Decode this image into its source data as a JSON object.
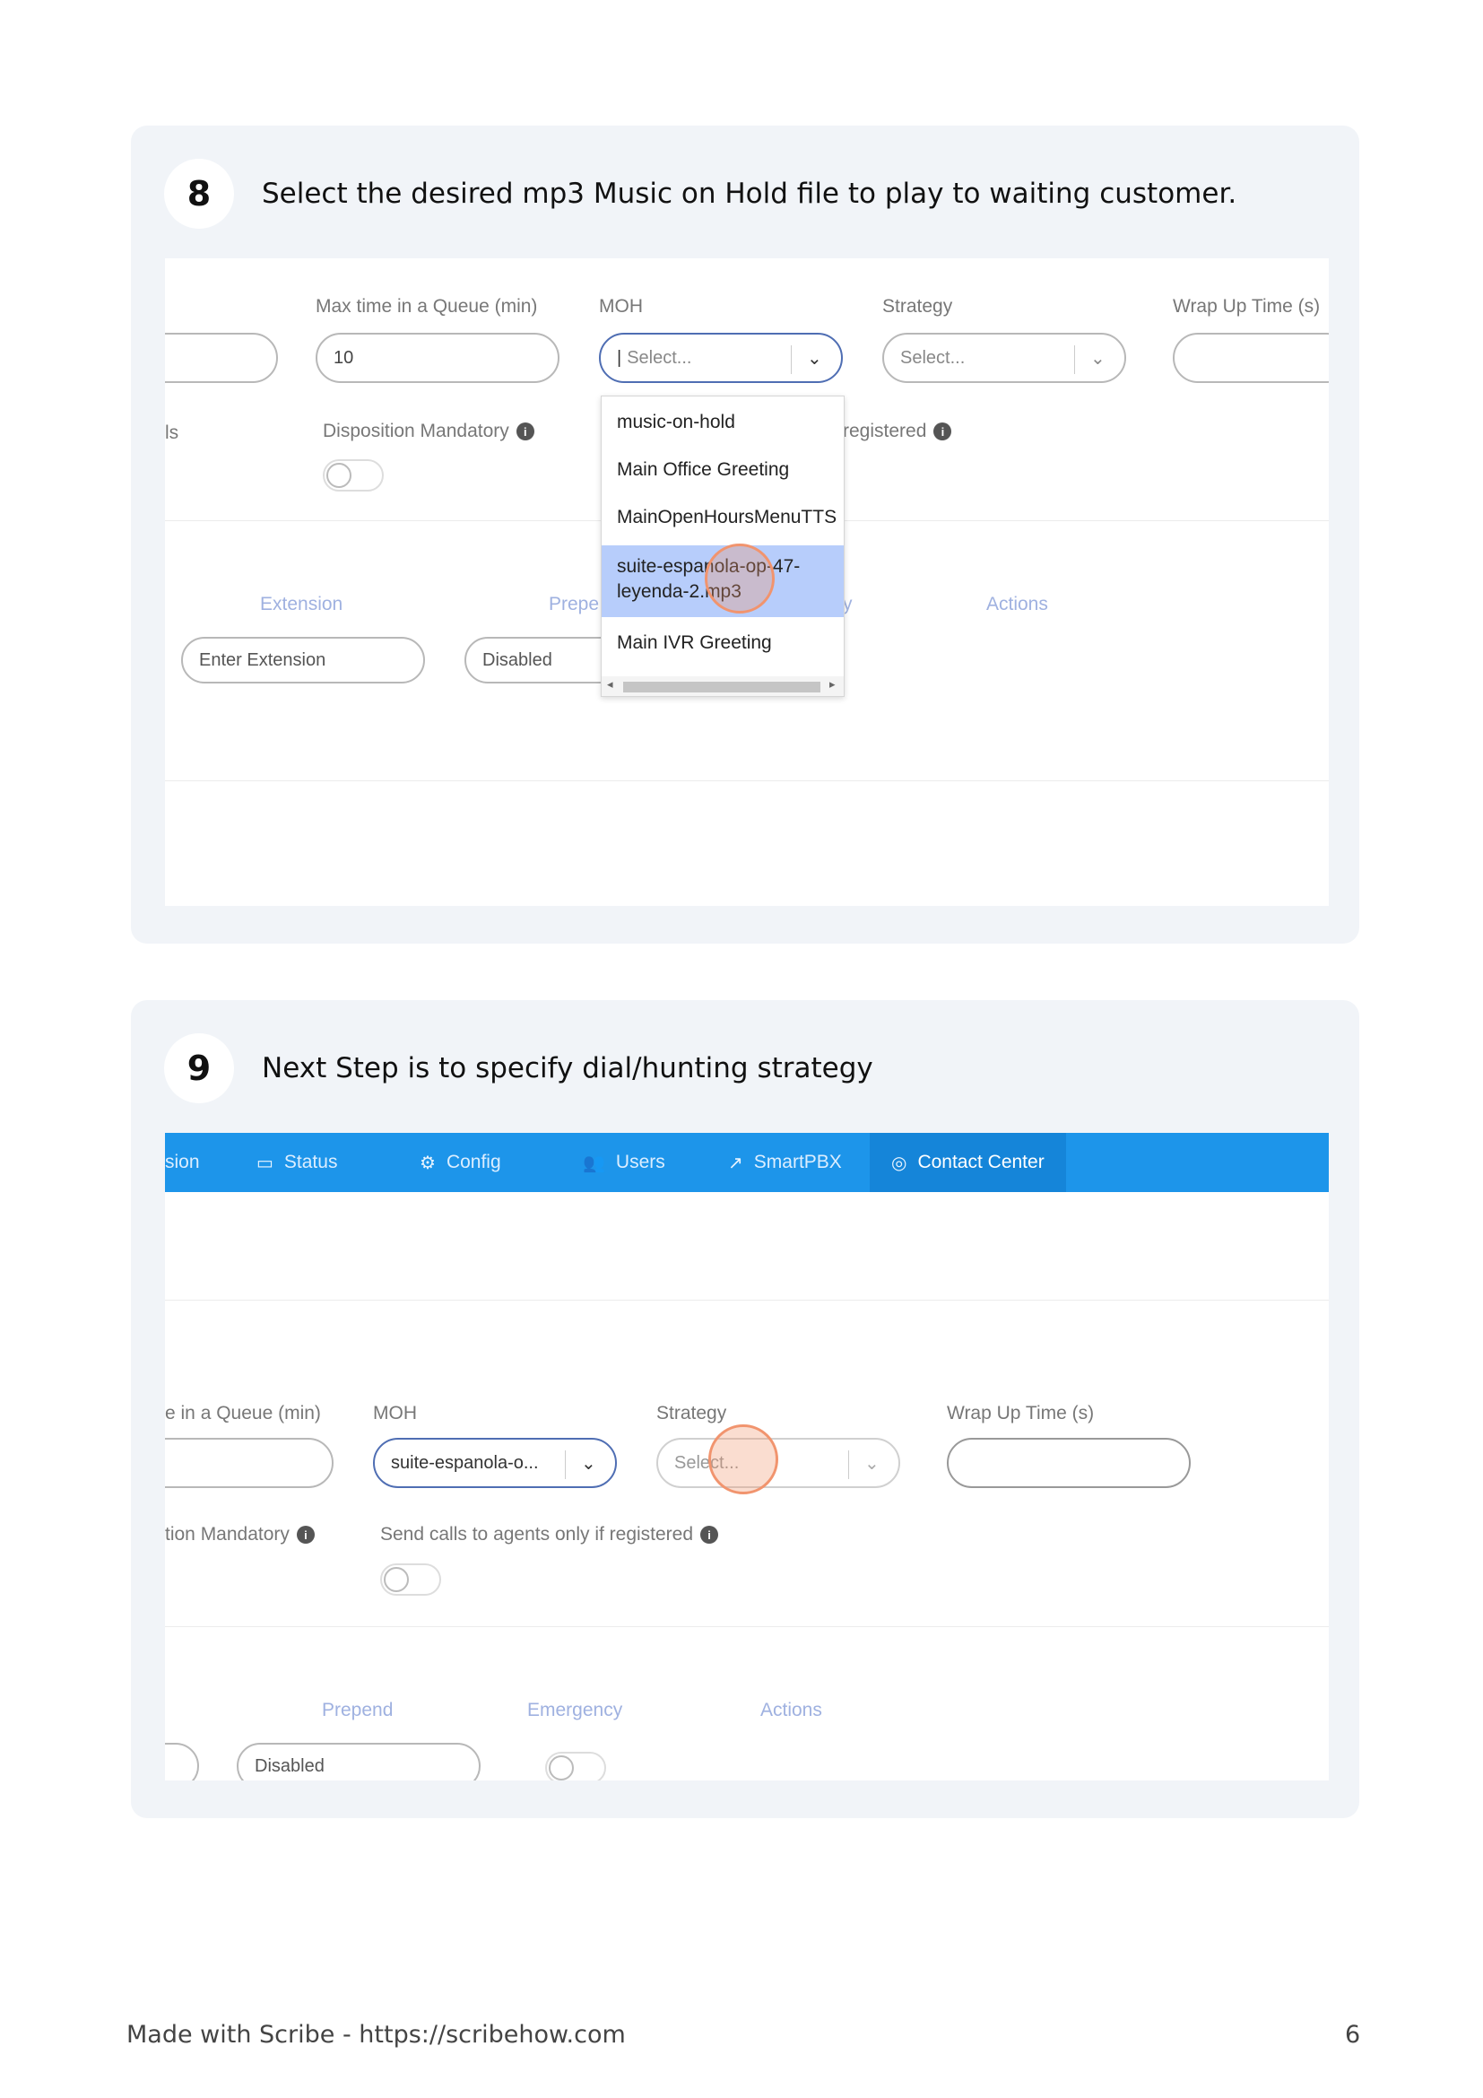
{
  "step8": {
    "number": "8",
    "text": "Select the desired mp3 Music on Hold file to play to waiting customer.",
    "labels": {
      "max_time": "Max time in a Queue (min)",
      "moh": "MOH",
      "strategy": "Strategy",
      "wrap_up": "Wrap Up Time (s)",
      "row2_left": "ls",
      "disposition": "Disposition Mandatory",
      "registered": "registered"
    },
    "fields": {
      "max_time_value": "10",
      "moh_value": "Select...",
      "strategy_value": "Select..."
    },
    "dropdown_items": [
      "music-on-hold",
      "Main Office Greeting",
      "MainOpenHoursMenuTTS",
      "suite-espanola-op-47-leyenda-2.mp3",
      "Main IVR Greeting"
    ],
    "columns": {
      "extension": "Extension",
      "prepend": "Prepe",
      "emergency_tail": "y",
      "actions": "Actions"
    },
    "row": {
      "extension_placeholder": "Enter Extension",
      "prepend_value": "Disabled"
    }
  },
  "step9": {
    "number": "9",
    "text": "Next Step is to specify dial/hunting strategy",
    "nav": [
      {
        "label": "sion",
        "icon": ""
      },
      {
        "label": "Status",
        "icon": "monitor-icon"
      },
      {
        "label": "Config",
        "icon": "gear-icon"
      },
      {
        "label": "Users",
        "icon": "users-icon"
      },
      {
        "label": "SmartPBX",
        "icon": "external-link-icon"
      },
      {
        "label": "Contact Center",
        "icon": "headset-icon"
      }
    ],
    "labels": {
      "max_time": "e in a Queue (min)",
      "moh": "MOH",
      "strategy": "Strategy",
      "wrap_up": "Wrap Up Time (s)",
      "disposition": "tion Mandatory",
      "send_calls": "Send calls to agents only if registered"
    },
    "fields": {
      "moh_value": "suite-espanola-o...",
      "strategy_value": "Select..."
    },
    "columns": {
      "prepend": "Prepend",
      "emergency": "Emergency",
      "actions": "Actions"
    },
    "row": {
      "prepend_value": "Disabled"
    }
  },
  "footer": {
    "credit": "Made with Scribe - https://scribehow.com",
    "page": "6"
  }
}
